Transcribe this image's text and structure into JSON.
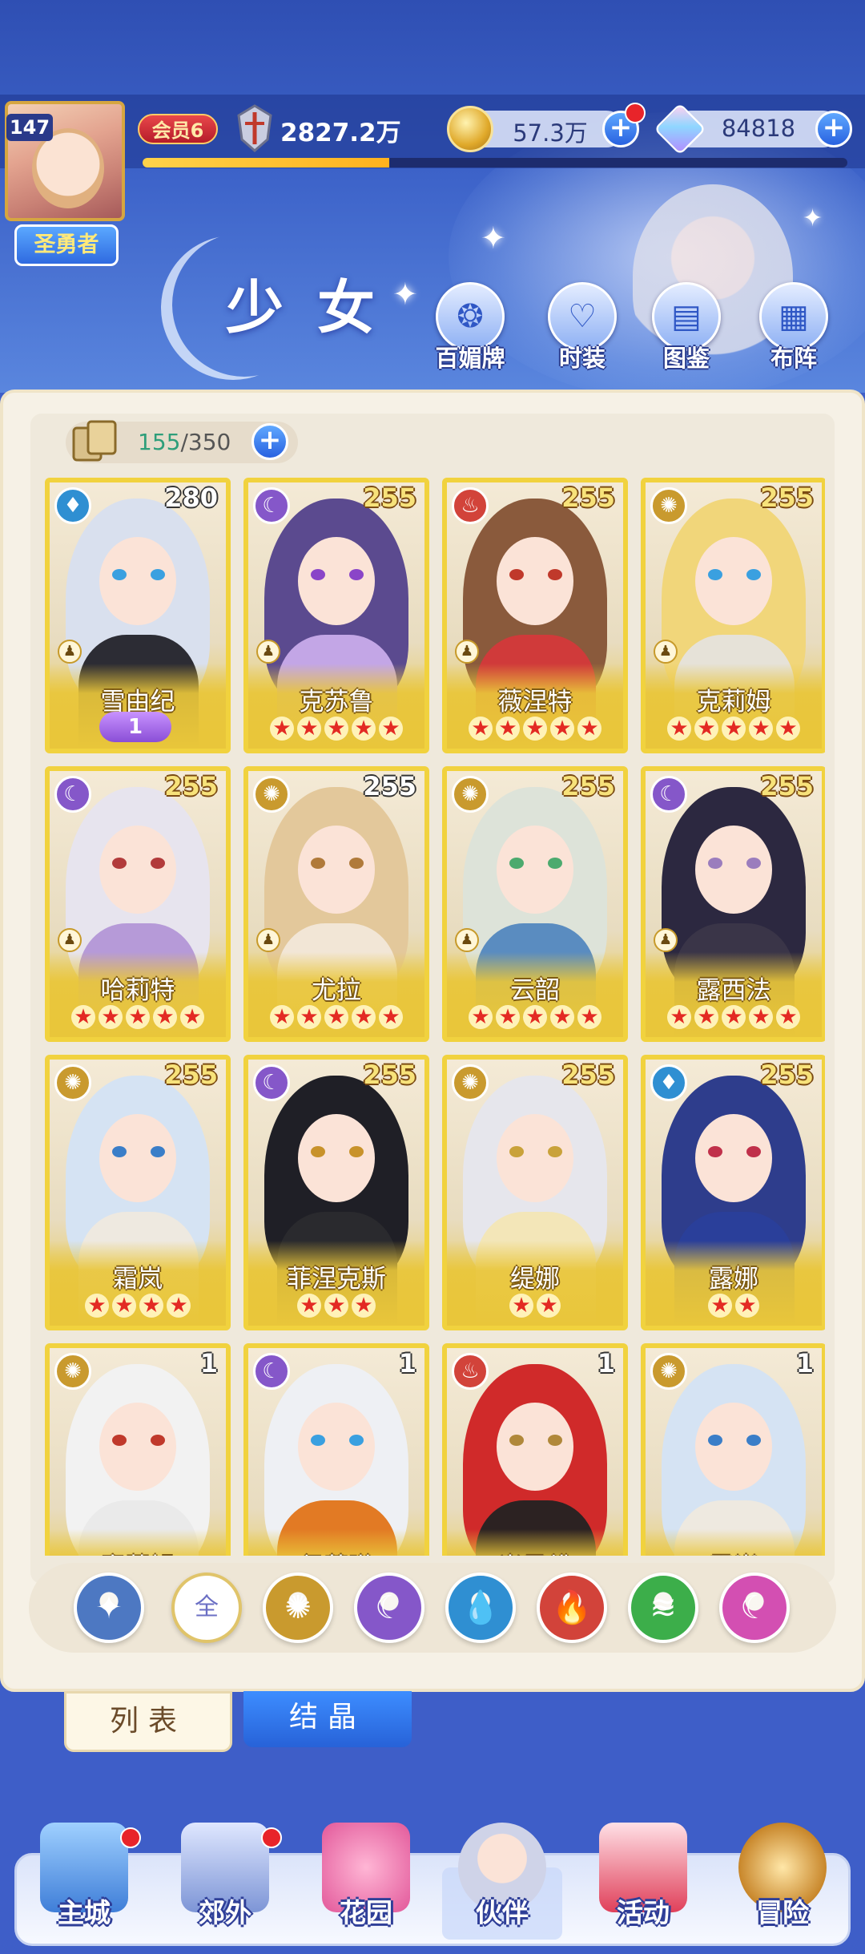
{
  "player": {
    "level": "147",
    "title": "圣勇者",
    "vip": "会员6",
    "power": "2827.2万",
    "xp_progress": 0.35
  },
  "currency": {
    "gold": "57.3万",
    "gems": "84818"
  },
  "page": {
    "title": "少女"
  },
  "header_buttons": [
    {
      "label": "百媚牌",
      "icon": "badge-icon"
    },
    {
      "label": "时装",
      "icon": "outfit-icon"
    },
    {
      "label": "图鉴",
      "icon": "book-icon"
    },
    {
      "label": "布阵",
      "icon": "formation-grid-icon"
    }
  ],
  "capacity": {
    "current": "155",
    "max": "/350"
  },
  "characters": [
    {
      "name": "雪由纪",
      "level": "280",
      "element": "water",
      "stars": 0,
      "awaken": "1",
      "hair": "#d9e0ee",
      "eye": "#3aa0e0",
      "body": "#2c2c34"
    },
    {
      "name": "克苏鲁",
      "level": "255",
      "element": "moon",
      "stars": 5,
      "awaken": "",
      "hair": "#5b4a8f",
      "eye": "#8a45c8",
      "body": "#c3a6e6"
    },
    {
      "name": "薇涅特",
      "level": "255",
      "element": "fire",
      "stars": 5,
      "awaken": "",
      "hair": "#8a5a3c",
      "eye": "#c0392b",
      "body": "#d03a3a"
    },
    {
      "name": "克莉姆",
      "level": "255",
      "element": "sun",
      "stars": 5,
      "awaken": "",
      "hair": "#f1d67a",
      "eye": "#3aa0e0",
      "body": "#e6e2d8"
    },
    {
      "name": "哈莉特",
      "level": "255",
      "element": "moon",
      "stars": 5,
      "awaken": "",
      "hair": "#e7e4ee",
      "eye": "#b23b3b",
      "body": "#b69ad8"
    },
    {
      "name": "尤拉",
      "level": "255",
      "element": "sun",
      "stars": 5,
      "awaken": "",
      "hair": "#e3c89b",
      "eye": "#b07a3a",
      "body": "#f2e6d6"
    },
    {
      "name": "云韶",
      "level": "255",
      "element": "sun",
      "stars": 5,
      "awaken": "",
      "hair": "#dde3d9",
      "eye": "#4caa6e",
      "body": "#5a8cc0"
    },
    {
      "name": "露西法",
      "level": "255",
      "element": "moon",
      "stars": 5,
      "awaken": "",
      "hair": "#2c2840",
      "eye": "#9b7dbd",
      "body": "#3a3548"
    },
    {
      "name": "霜岚",
      "level": "255",
      "element": "sun",
      "stars": 4,
      "awaken": "",
      "hair": "#d5e3f3",
      "eye": "#3a7ec8",
      "body": "#eee9e0"
    },
    {
      "name": "菲涅克斯",
      "level": "255",
      "element": "moon",
      "stars": 3,
      "awaken": "",
      "hair": "#1f1f26",
      "eye": "#c8922a",
      "body": "#2a2a2e"
    },
    {
      "name": "缇娜",
      "level": "255",
      "element": "sun",
      "stars": 2,
      "awaken": "",
      "hair": "#e6e6ec",
      "eye": "#c9a23a",
      "body": "#f3e6b8"
    },
    {
      "name": "露娜",
      "level": "255",
      "element": "water",
      "stars": 2,
      "awaken": "",
      "hair": "#2e3d8c",
      "eye": "#c0304a",
      "body": "#2a3f9a"
    },
    {
      "name": "蜜莉姆",
      "level": "1",
      "element": "sun",
      "stars": 0,
      "awaken": "",
      "hair": "#f2f2f2",
      "eye": "#c0392b",
      "body": "#eaeaea"
    },
    {
      "name": "伊芙琳",
      "level": "1",
      "element": "moon",
      "stars": 0,
      "awaken": "",
      "hair": "#eef0f4",
      "eye": "#3aa0e0",
      "body": "#e27a24"
    },
    {
      "name": "米灵绯",
      "level": "1",
      "element": "fire",
      "stars": 0,
      "awaken": "",
      "hair": "#d02a2a",
      "eye": "#b0883a",
      "body": "#2c2222"
    },
    {
      "name": "霜岚",
      "level": "1",
      "element": "sun",
      "stars": 0,
      "awaken": "",
      "hair": "#d5e3f3",
      "eye": "#3a7ec8",
      "body": "#eee9e0"
    }
  ],
  "filters": [
    {
      "key": "special",
      "icon": "star-burst-icon",
      "color": "#4d78c2",
      "symbol": "✦"
    },
    {
      "key": "all",
      "label": "全",
      "selected": true
    },
    {
      "key": "sun",
      "icon": "sun-icon",
      "color": "#c99a2e",
      "symbol": "✺"
    },
    {
      "key": "moon",
      "icon": "moon-icon",
      "color": "#8557c9",
      "symbol": "☾"
    },
    {
      "key": "water",
      "icon": "water-drop-icon",
      "color": "#2f8fd2",
      "symbol": "💧"
    },
    {
      "key": "fire",
      "icon": "flame-icon",
      "color": "#d2433a",
      "symbol": "🔥"
    },
    {
      "key": "wind",
      "icon": "whirlwind-icon",
      "color": "#3cae4a",
      "symbol": "≋"
    },
    {
      "key": "star",
      "icon": "pink-star-icon",
      "color": "#d34fb2",
      "symbol": "☾"
    }
  ],
  "bottom_tabs": {
    "list": "列表",
    "crystal": "结晶"
  },
  "nav": [
    {
      "label": "主城",
      "icon": "castle-icon",
      "badge": true
    },
    {
      "label": "郊外",
      "icon": "shrine-icon",
      "badge": true
    },
    {
      "label": "花园",
      "icon": "heart-icon",
      "badge": false
    },
    {
      "label": "伙伴",
      "icon": "companion-icon",
      "badge": false,
      "active": true
    },
    {
      "label": "活动",
      "icon": "gift-icon",
      "badge": false
    },
    {
      "label": "冒险",
      "icon": "compass-icon",
      "badge": false
    }
  ],
  "colors": {
    "element_sun": "#c99a2e",
    "element_moon": "#8557c9",
    "element_water": "#2f8fd2",
    "element_fire": "#d2433a",
    "card_gold": "#e9c63a"
  }
}
